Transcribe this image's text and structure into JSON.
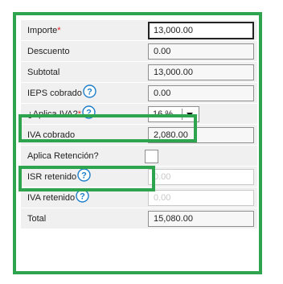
{
  "form": {
    "importe": {
      "label": "Importe",
      "required_mark": "*",
      "value": "13,000.00"
    },
    "descuento": {
      "label": "Descuento",
      "value": "0.00"
    },
    "subtotal": {
      "label": "Subtotal",
      "value": "13,000.00"
    },
    "ieps": {
      "label": "IEPS cobrado",
      "value": "0.00"
    },
    "aplica_iva": {
      "label": "¿Aplica IVA?",
      "required_mark": "*",
      "selected": "16 %"
    },
    "iva_cobrado": {
      "label": "IVA cobrado",
      "value": "2,080.00"
    },
    "aplica_retencion": {
      "label": "Aplica Retención?",
      "checked": false
    },
    "isr_retenido": {
      "label": "ISR retenido",
      "value": "0.00"
    },
    "iva_retenido": {
      "label": "IVA retenido",
      "value": "0.00"
    },
    "total": {
      "label": "Total",
      "value": "15,080.00"
    }
  },
  "colors": {
    "highlight": "#2ea44f",
    "help_icon": "#1e7ec8",
    "required": "#e41d1d"
  },
  "icons": {
    "help": "help-circle-icon",
    "dropdown": "chevron-down-icon"
  }
}
